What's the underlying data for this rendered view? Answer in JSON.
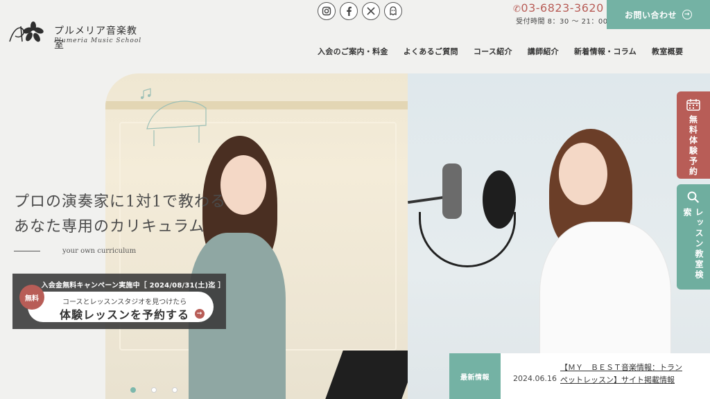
{
  "header": {
    "logo_jp": "プルメリア音楽教室",
    "logo_en": "Plumeria Music School",
    "phone": "03-6823-3620",
    "hours": "受付時間 8：30 〜 21：00",
    "contact_label": "お問い合わせ"
  },
  "social": [
    "instagram-icon",
    "facebook-icon",
    "x-icon",
    "ghost-icon"
  ],
  "nav": [
    {
      "label": "入会のご案内・料金"
    },
    {
      "label": "よくあるご質問"
    },
    {
      "label": "コース紹介"
    },
    {
      "label": "講師紹介"
    },
    {
      "label": "新着情報・コラム"
    },
    {
      "label": "教室概要"
    }
  ],
  "hero": {
    "tagline_line1": "プロの演奏家に1対1で教わる",
    "tagline_line2": "あなた専用のカリキュラム",
    "tagline_en": "your own curriculum"
  },
  "campaign": {
    "title": "入会金無料キャンペーン実施中［ 2024/08/31(土)迄 ］",
    "badge": "無料",
    "sub": "コースとレッスンスタジオを見つけたら",
    "main": "体験レッスンを予約する"
  },
  "side_tabs": {
    "reserve": "無料体験予約",
    "search": "レッスン教室検索"
  },
  "news": {
    "label": "最新情報",
    "date": "2024.06.16",
    "title": "【ＭＹ　ＢＥＳＴ音楽情報：トランペットレッスン】サイト掲載情報"
  },
  "slider": {
    "count": 3,
    "active": 1
  },
  "colors": {
    "accent_green": "#74b2a4",
    "accent_red": "#b85d57"
  }
}
